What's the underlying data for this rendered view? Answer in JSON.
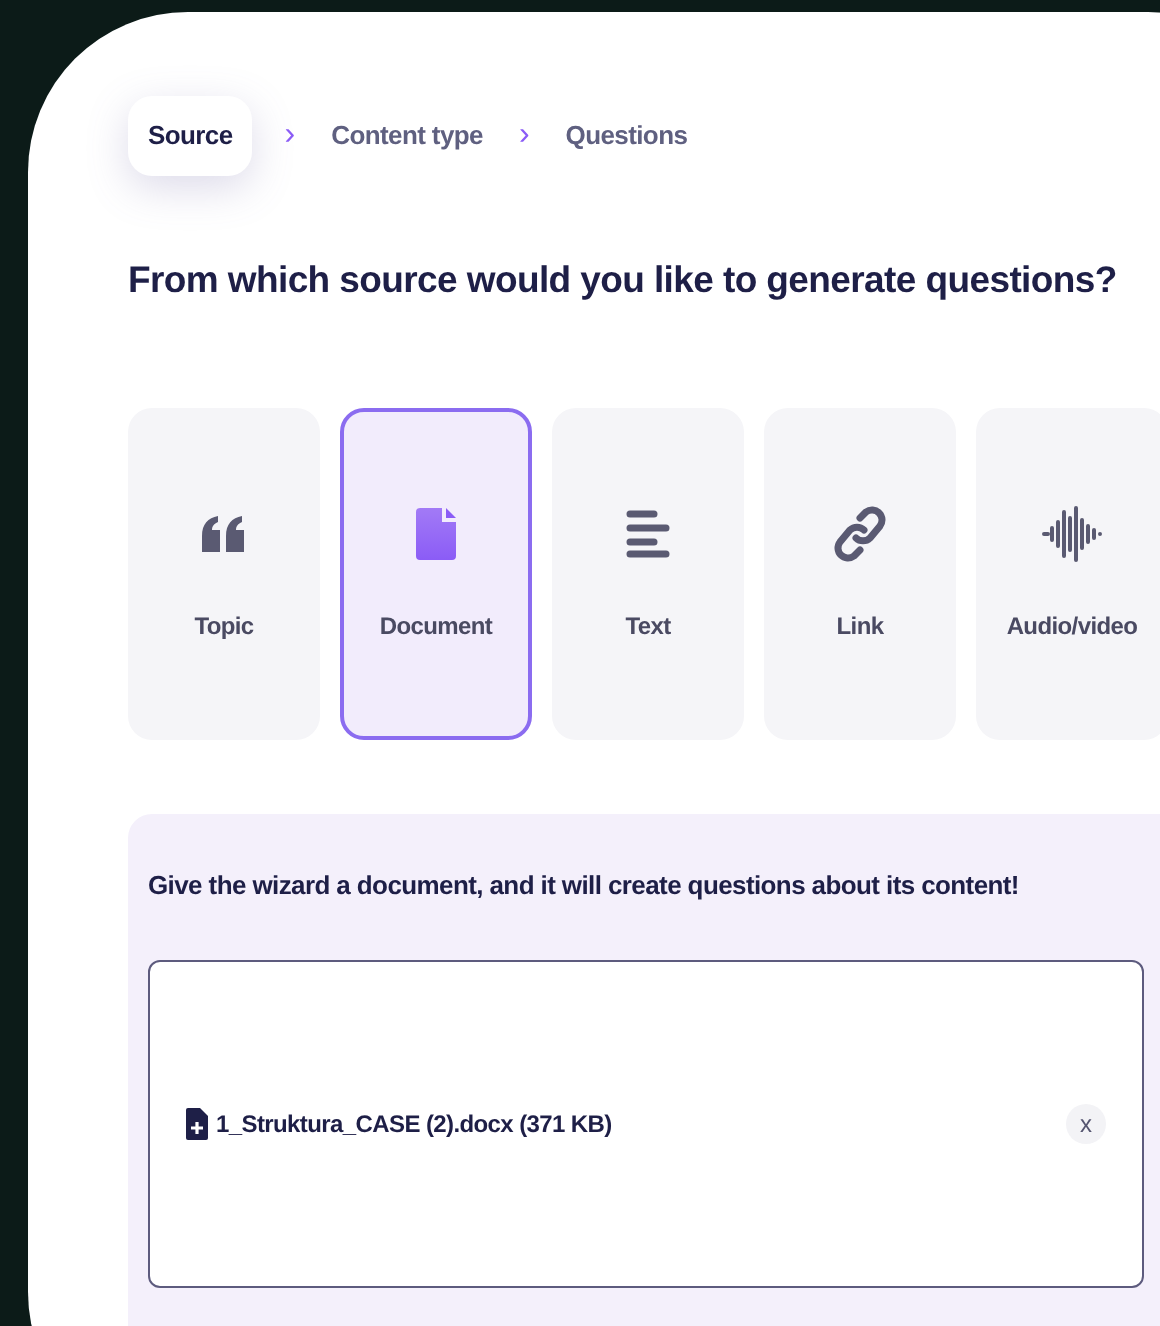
{
  "breadcrumb": [
    {
      "label": "Source",
      "selected": true
    },
    {
      "label": "Content type",
      "selected": false
    },
    {
      "label": "Questions",
      "selected": false
    }
  ],
  "separator": "›",
  "heading": "From which source would you like to generate questions?",
  "sources": [
    {
      "kind": "quote",
      "label": "Topic",
      "selected": false
    },
    {
      "kind": "document",
      "label": "Document",
      "selected": true
    },
    {
      "kind": "text",
      "label": "Text",
      "selected": false
    },
    {
      "kind": "link",
      "label": "Link",
      "selected": false
    },
    {
      "kind": "wave",
      "label": "Audio/video",
      "selected": false
    }
  ],
  "panel": {
    "prompt": "Give the wizard a document, and it will create questions about its content!",
    "file": {
      "name": "1_Struktura_CASE (2).docx (371 KB)",
      "remove": "x"
    }
  }
}
